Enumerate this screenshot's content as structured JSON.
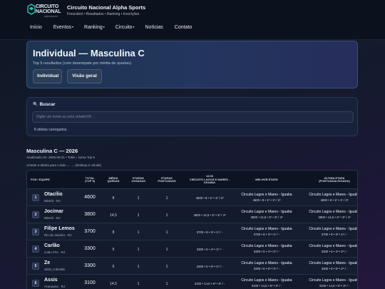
{
  "brand": {
    "logo_line1": "CIRCUITO",
    "logo_line2": "NACIONAL",
    "logo_sub": "alpha sports",
    "title": "Circuito Nacional Alpha Sports",
    "subtitle": "Frescobol • Resultados • Ranking • Inscrições"
  },
  "nav": [
    {
      "label": "Início",
      "caret": ""
    },
    {
      "label": "Eventos",
      "caret": "▾"
    },
    {
      "label": "Ranking",
      "caret": "▾"
    },
    {
      "label": "Circuito",
      "caret": "▾"
    },
    {
      "label": "Notícias",
      "caret": ""
    },
    {
      "label": "Contato",
      "caret": ""
    }
  ],
  "hero": {
    "title": "Individual — Masculina C",
    "subtitle": "Top 5 resultados (com desempate por média de quedas).",
    "btn_individual": "Individual",
    "btn_overview": "Visão geral"
  },
  "search": {
    "label": "Buscar",
    "placeholder": "Digite um nome ou uma cidade/UF...",
    "value": "",
    "loaded_text": "8 atletas carregados."
  },
  "category": {
    "title": "Masculina C — 2026",
    "updated": "Atualizado em: 2026-03-21 • Total = soma Top 5",
    "hint": "Arraste a tabela para o lado ← → (desktop e celular)"
  },
  "table": {
    "headers": {
      "pos": "POS / EQUIPE",
      "total_a": "TOTAL",
      "total_b": "(TOP 5)",
      "media_a": "MÉDIA",
      "media_b": "QUEDAS",
      "etj_a": "ETAPAS",
      "etj_b": "JOGADAS",
      "etp_a": "ETAPAS",
      "etp_b": "PONTUADAS",
      "det_a": "14.03",
      "det_b": "CIRCUITO LAGOS E MARES -",
      "det_c": "IGUABA",
      "best": "MELHOR ETAPA",
      "last_a": "ÚLTIMA ETAPA",
      "last_b": "(PONTUADA/JOGADA)"
    },
    "rows": [
      {
        "pos": "1",
        "name": "Otacílio",
        "city": "Niterói - RJ",
        "total": "4600",
        "media": "8",
        "jogadas": "1",
        "pontuadas": "1",
        "detail": "4600 • 8 • 1º • 1º / 2º",
        "best_name": "Circuito Lagos e Mares - Iguaba",
        "best_detail": "4600 • 8 • 1º • 1º / 2º",
        "last_name": "Circuito Lagos e Mares - Iguaba",
        "last_detail": "4600 • 8 • 1º • 1º / 2º"
      },
      {
        "pos": "2",
        "name": "Jocimar",
        "city": "Niterói - RJ",
        "total": "3800",
        "media": "14,5",
        "jogadas": "1",
        "pontuadas": "1",
        "detail": "3800 • 14,5 • 2º • 3º / 4º",
        "best_name": "Circuito Lagos e Mares - Iguaba",
        "best_detail": "3800 • 14,5 • 2º • 3º / 4º",
        "last_name": "Circuito Lagos e Mares - Iguaba",
        "last_detail": "3800 • 14,5 • 2º • 3º / 4º"
      },
      {
        "pos": "3",
        "name": "Filipe Lemos",
        "city": "Rio de Janeiro - RJ",
        "total": "3700",
        "media": "8",
        "jogadas": "1",
        "pontuadas": "1",
        "detail": "3700 • 8 • 3º • 1º / -",
        "best_name": "Circuito Lagos e Mares - Iguaba",
        "best_detail": "3700 • 8 • 3º • 1º / -",
        "last_name": "Circuito Lagos e Mares - Iguaba",
        "last_detail": "3700 • 8 • 3º • 1º / -"
      },
      {
        "pos": "4",
        "name": "Carlão",
        "city": "Cabo Frio - RJ",
        "total": "3300",
        "media": "5",
        "jogadas": "1",
        "pontuadas": "1",
        "detail": "3300 • 5 • 4º • 2º / -",
        "best_name": "Circuito Lagos e Mares - Iguaba",
        "best_detail": "3300 • 5 • 4º • 2º / -",
        "last_name": "Circuito Lagos e Mares - Iguaba",
        "last_detail": "3300 • 5 • 4º • 2º / -"
      },
      {
        "pos": "5",
        "name": "Ze",
        "city": "SEM_CIDADE",
        "total": "3300",
        "media": "5",
        "jogadas": "1",
        "pontuadas": "1",
        "detail": "3300 • 5 • 5º • 2º / -",
        "best_name": "Circuito Lagos e Mares - Iguaba",
        "best_detail": "3300 • 5 • 5º • 2º / -",
        "last_name": "Circuito Lagos e Mares - Iguaba",
        "last_detail": "3300 • 5 • 5º • 2º / -"
      },
      {
        "pos": "6",
        "name": "Assis",
        "city": "Araruama - RJ",
        "total": "3100",
        "media": "14,5",
        "jogadas": "1",
        "pontuadas": "1",
        "detail": "3100 • 14,5 • 6º • 3º / -",
        "best_name": "Circuito Lagos e Mares - Iguaba",
        "best_detail": "3100 • 14,5 • 6º • 3º / -",
        "last_name": "Circuito Lagos e Mares - Iguaba",
        "last_detail": "3100 • 14,5 • 6º • 3º / -"
      }
    ]
  }
}
